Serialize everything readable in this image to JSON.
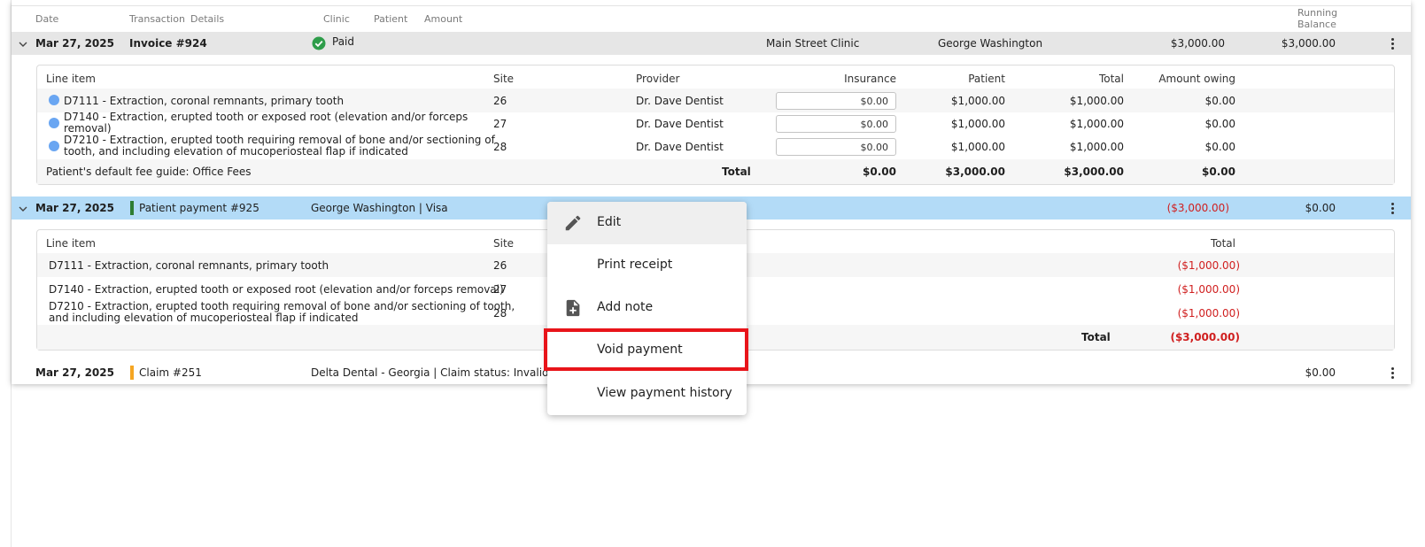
{
  "header": {
    "date": "Date",
    "transaction": "Transaction",
    "details": "Details",
    "clinic": "Clinic",
    "patient": "Patient",
    "amount": "Amount",
    "running": "Running",
    "balance": "Balance"
  },
  "invoice": {
    "date": "Mar 27, 2025",
    "title": "Invoice #924",
    "status": "Paid",
    "clinic": "Main Street Clinic",
    "patient": "George Washington",
    "amount": "$3,000.00",
    "running_balance": "$3,000.00",
    "columns": {
      "line_item": "Line item",
      "site": "Site",
      "provider": "Provider",
      "insurance": "Insurance",
      "patient": "Patient",
      "total": "Total",
      "amount_owing": "Amount owing"
    },
    "lines": [
      {
        "desc1": "D7111 - Extraction, coronal remnants, primary tooth",
        "desc2": "",
        "site": "26",
        "provider": "Dr. Dave Dentist",
        "insurance": "$0.00",
        "patient": "$1,000.00",
        "total": "$1,000.00",
        "owing": "$0.00"
      },
      {
        "desc1": "D7140 - Extraction, erupted tooth or exposed root (elevation and/or forceps",
        "desc2": "removal)",
        "site": "27",
        "provider": "Dr. Dave Dentist",
        "insurance": "$0.00",
        "patient": "$1,000.00",
        "total": "$1,000.00",
        "owing": "$0.00"
      },
      {
        "desc1": "D7210 - Extraction, erupted tooth requiring removal of bone and/or sectioning of",
        "desc2": "tooth, and including elevation of mucoperiosteal flap if indicated",
        "site": "28",
        "provider": "Dr. Dave Dentist",
        "insurance": "$0.00",
        "patient": "$1,000.00",
        "total": "$1,000.00",
        "owing": "$0.00"
      }
    ],
    "fee_guide": "Patient's default fee guide: Office Fees",
    "total_label": "Total",
    "totals": {
      "insurance": "$0.00",
      "patient": "$3,000.00",
      "total": "$3,000.00",
      "owing": "$0.00"
    }
  },
  "payment": {
    "date": "Mar 27, 2025",
    "title": "Patient payment #925",
    "details": "George Washington | Visa",
    "amount": "($3,000.00)",
    "running_balance": "$0.00",
    "columns": {
      "line_item": "Line item",
      "site": "Site",
      "total": "Total"
    },
    "lines": [
      {
        "desc1": "D7111 - Extraction, coronal remnants, primary tooth",
        "desc2": "",
        "site": "26",
        "total": "($1,000.00)"
      },
      {
        "desc1": "D7140 - Extraction, erupted tooth or exposed root (elevation and/or forceps removal)",
        "desc2": "",
        "site": "27",
        "total": "($1,000.00)"
      },
      {
        "desc1": "D7210 - Extraction, erupted tooth requiring removal of bone and/or sectioning of tooth,",
        "desc2": "and including elevation of mucoperiosteal flap if indicated",
        "site": "28",
        "total": "($1,000.00)"
      }
    ],
    "total_label": "Total",
    "total": "($3,000.00)"
  },
  "claim": {
    "date": "Mar 27, 2025",
    "title": "Claim #251",
    "details": "Delta Dental - Georgia | Claim status: Invalid | C",
    "running_balance": "$0.00"
  },
  "context_menu": {
    "items": [
      {
        "label": "Edit",
        "icon": "pencil-icon"
      },
      {
        "label": "Print receipt",
        "icon": ""
      },
      {
        "label": "Add note",
        "icon": "note-add-icon"
      },
      {
        "label": "Void payment",
        "icon": ""
      },
      {
        "label": "View payment history",
        "icon": ""
      }
    ]
  },
  "colors": {
    "invoice_row": "#e6e6e6",
    "payment_row": "#b3dbf7",
    "paid_green": "#2e9d4a",
    "payment_bar": "#2e7d32",
    "claim_bar": "#f5a623",
    "negative": "#d01f1f",
    "highlight": "#e8141a"
  }
}
